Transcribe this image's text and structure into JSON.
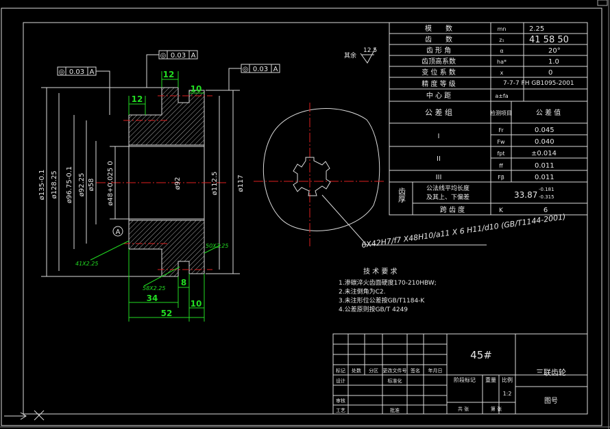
{
  "params": {
    "rows": [
      {
        "name": "模　　数",
        "symbol": "mn",
        "value": "2.25"
      },
      {
        "name": "齿　　数",
        "symbol": "z₁",
        "value": "41 58 50"
      },
      {
        "name": "齿 形 角",
        "symbol": "α",
        "value": "20°"
      },
      {
        "name": "齿顶高系数",
        "symbol": "ha*",
        "value": "1.0"
      },
      {
        "name": "变 位 系 数",
        "symbol": "x",
        "value": "0"
      },
      {
        "name": "精 度 等 级",
        "symbol": "",
        "value": "7-7-7 FH GB1095-2001"
      },
      {
        "name": "中 心 距",
        "symbol": "a±fa",
        "value": ""
      }
    ],
    "tol_header": {
      "group": "公 差 组",
      "item": "检测项目",
      "value": "公 差 值"
    },
    "tol_rows": [
      {
        "group": "I",
        "item": "Fr",
        "value": "0.045"
      },
      {
        "group": "",
        "item": "Fw",
        "value": "0.040"
      },
      {
        "group": "II",
        "item": "fpt",
        "value": "±0.014"
      },
      {
        "group": "",
        "item": "ff",
        "value": "0.011"
      },
      {
        "group": "III",
        "item": "Fβ",
        "value": "0.011"
      }
    ],
    "thickness": {
      "label": "齿厚",
      "row1": "公法线平均长度",
      "row2": "及其上、下偏差",
      "value": "33.87",
      "dev_upper": "-0.181",
      "dev_lower": "-0.315"
    },
    "span": {
      "label": "跨 齿 度",
      "symbol": "K",
      "value": "6"
    }
  },
  "roughness": {
    "prefix": "其余",
    "value": "12.5"
  },
  "gdt": [
    {
      "symbol": "◎",
      "value": "0.03",
      "datum": "A"
    },
    {
      "symbol": "◎",
      "value": "0.03",
      "datum": "A"
    },
    {
      "symbol": "◎",
      "value": "0.03",
      "datum": "A"
    }
  ],
  "dims": {
    "d135": "ø135-0.1",
    "d128": "ø128.25",
    "d96": "ø96.75-0.1",
    "d92_25": "ø92.25",
    "d58": "ø58",
    "d48": "ø48+0.025 0",
    "d92": "ø92",
    "d112": "ø112.5",
    "d117": "ø117",
    "w12a": "12",
    "w12b": "12",
    "w10a": "10",
    "w10b": "10",
    "w8": "8",
    "w34": "34",
    "w52": "52",
    "ch1": "41X2.25",
    "ch2": "50X2.25",
    "ch3": "58X2.25",
    "datum": "A"
  },
  "spline": "6X42H7/f7 X48H10/a11 X 6 H11/d10 (GB/T1144-2001)",
  "tech": {
    "title": "技 术 要 求",
    "items": [
      "1.渗碳淬火齿面硬度170-210HBW;",
      "2.未注倒角为C2.",
      "3.未注形位公差按GB/T1184-K",
      "4.公差原则按GB/T 4249"
    ]
  },
  "title_block": {
    "material": "45#",
    "name": "三联齿轮",
    "drawing_no": "图号",
    "scale_label": "比例",
    "scale": "1:2",
    "weight": "重量",
    "stage": "阶段标记",
    "row_labels": [
      "标记",
      "处数",
      "分区",
      "更改文件号",
      "签名",
      "年月日"
    ],
    "left_labels": [
      "设计",
      "审核",
      "工艺"
    ],
    "mid_labels": [
      "标准化",
      "批准"
    ],
    "bottom_labels": [
      "共 张",
      "第 张"
    ]
  }
}
